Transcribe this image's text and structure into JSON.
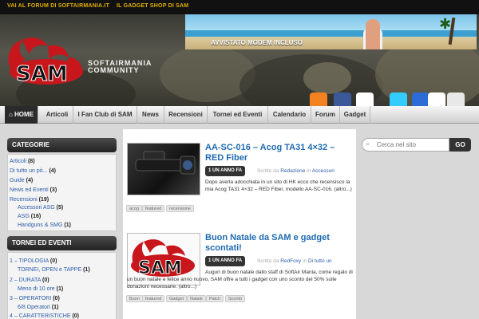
{
  "topbar": {
    "links": [
      "VAI AL FORUM DI SOFTAIRMANIA.IT",
      "IL GADGET SHOP DI SAM"
    ]
  },
  "banner": {
    "caption": "AVVISTATO MODEM INCLUSO"
  },
  "logo": {
    "mark": "SAM",
    "line1": "SOFTAIRMANIA",
    "line2": "COMMUNITY"
  },
  "nav": {
    "items": [
      "HOME",
      "Articoli",
      "I Fan Club di SAM",
      "News",
      "Recensioni",
      "Tornei ed Eventi",
      "Calendario",
      "Forum",
      "Gadget"
    ]
  },
  "search": {
    "placeholder": "Cerca nel sito",
    "button": "GO"
  },
  "sidebar": {
    "categories_title": "CATEGORIE",
    "categories": [
      {
        "name": "Articoli",
        "count": "(8)"
      },
      {
        "name": "Di tutto un pò...",
        "count": "(4)"
      },
      {
        "name": "Guide",
        "count": "(4)"
      },
      {
        "name": "News ed Eventi",
        "count": "(3)"
      },
      {
        "name": "Recensioni",
        "count": "(19)"
      },
      {
        "name": "Accessori ASG",
        "count": "(5)"
      },
      {
        "name": "ASG",
        "count": "(16)"
      },
      {
        "name": "Handguns & SMG",
        "count": "(1)"
      }
    ],
    "tornei_title": "TORNEI ED EVENTI",
    "tornei": [
      {
        "name": "1 – TIPOLOGIA",
        "count": "(0)"
      },
      {
        "name": "TORNEI, OPEN e TAPPE",
        "count": "(1)"
      },
      {
        "name": "2 – DURATA",
        "count": "(0)"
      },
      {
        "name": "Meno di 10 ore",
        "count": "(1)"
      },
      {
        "name": "3 – OPERATORI",
        "count": "(0)"
      },
      {
        "name": "6/8 Operatori",
        "count": "(1)"
      },
      {
        "name": "4 – CARATTERISTICHE",
        "count": "(0)"
      }
    ]
  },
  "posts": [
    {
      "title": "AA-SC-016 – Acog TA31 4×32 – RED Fiber",
      "date": "1 UN ANNO FA",
      "meta_written": "Scritto da",
      "author": "Redazione",
      "meta_in": "in",
      "category": "Accessori",
      "excerpt": "Dopo averla adocchiata in un sito di HK ecco che recensisco la mia Acog TA31 4×32 – RED Fiber, modello AA-SC-016. (altro...)",
      "tags": [
        "acog",
        "featured",
        "recensione"
      ]
    },
    {
      "title": "Buon Natale da SAM e gadget scontati!",
      "date": "1 UN ANNO FA",
      "meta_written": "Scritto da",
      "author": "RedFoxy",
      "meta_in": "in",
      "category": "Di tutto un",
      "excerpt": "Auguri di buon natale dallo staff di SoftAir Mania, come regalo di un buon natale e felice anno nuovo, SAM offre a tutti i gadget con uno sconto del 50% sulle donazioni necessarie. (altro...)",
      "tags": [
        "Buon",
        "featured",
        "Gadget",
        "Natale",
        "Patch",
        "Sconto"
      ]
    }
  ],
  "colors": {
    "accent": "#1e6ab0",
    "topbar_link": "#e0b000",
    "logo_red": "#c8161d"
  }
}
